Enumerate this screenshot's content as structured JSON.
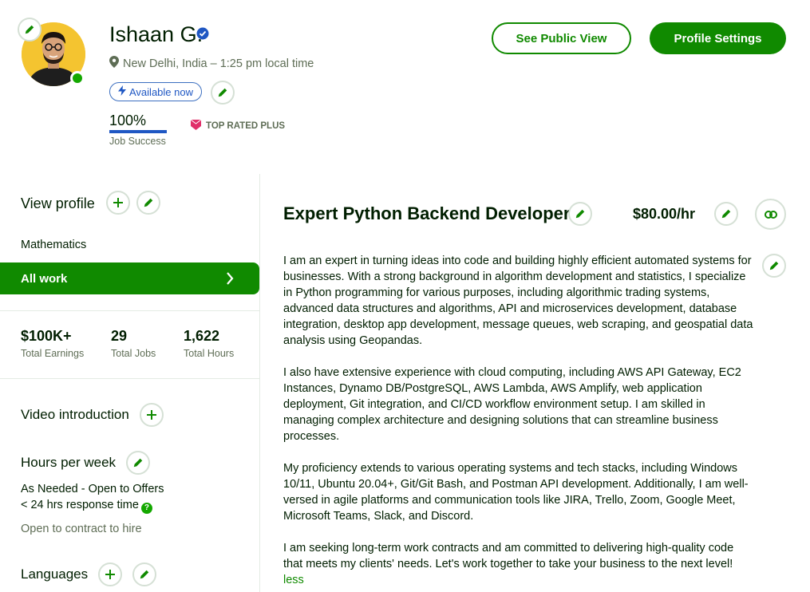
{
  "profile": {
    "name": "Ishaan G.",
    "location": "New Delhi, India – 1:25 pm local time",
    "availability": "Available now",
    "job_success_value": "100%",
    "job_success_label": "Job Success",
    "job_success_fraction": 1.0,
    "badge": "TOP RATED PLUS"
  },
  "header_buttons": {
    "public_view": "See Public View",
    "settings": "Profile Settings"
  },
  "sidebar": {
    "view_profile": "View profile",
    "category": "Mathematics",
    "all_work": "All work",
    "stats": [
      {
        "value": "$100K+",
        "label": "Total Earnings"
      },
      {
        "value": "29",
        "label": "Total Jobs"
      },
      {
        "value": "1,622",
        "label": "Total Hours"
      }
    ],
    "video_intro": "Video introduction",
    "hours_title": "Hours per week",
    "hours_value": "As Needed - Open to Offers",
    "response_time": "< 24 hrs response time",
    "contract_to_hire": "Open to contract to hire",
    "languages": "Languages"
  },
  "main": {
    "title": "Expert Python Backend Developer",
    "rate": "$80.00/hr",
    "overview": [
      "I am an expert in turning ideas into code and building highly efficient automated systems for businesses. With a strong background in algorithm development and statistics, I specialize in Python programming for various purposes, including algorithmic trading systems, advanced data structures and algorithms, API and microservices development, database integration, desktop app development, message queues, web scraping, and geospatial data analysis using Geopandas.",
      "I also have extensive experience with cloud computing, including AWS API Gateway, EC2 Instances, Dynamo DB/PostgreSQL, AWS Lambda, AWS Amplify, web application deployment, Git integration, and CI/CD workflow environment setup. I am skilled in managing complex architecture and designing solutions that can streamline business processes.",
      "My proficiency extends to various operating systems and tech stacks, including Windows 10/11, Ubuntu 20.04+, Git/Git Bash, and Postman API development. Additionally, I am well-versed in agile platforms and communication tools like JIRA, Trello, Zoom, Google Meet, Microsoft Teams, Slack, and Discord.",
      "I am seeking long-term work contracts and am committed to delivering high-quality code that meets my clients' needs. Let's work together to take your business to the next level!"
    ],
    "less": "less"
  },
  "icons": {
    "edit": "pencil-icon",
    "add": "plus-icon",
    "link": "link-icon",
    "location": "map-pin-icon",
    "verified": "verified-badge-icon",
    "availability": "lightning-icon",
    "chevron": "chevron-right-icon",
    "help": "question-icon"
  },
  "colors": {
    "brand_green": "#108a00",
    "online_green": "#14a800",
    "blue": "#1f57c3",
    "badge_pink": "#e0306a",
    "avatar_bg": "#f4c430"
  }
}
